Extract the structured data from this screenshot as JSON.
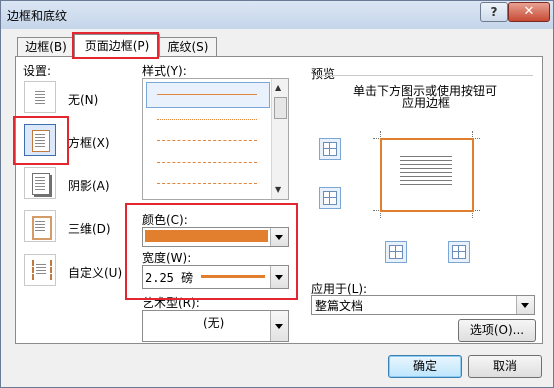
{
  "window": {
    "title": "边框和底纹",
    "help_glyph": "?",
    "close_glyph": "✕"
  },
  "tabs": [
    {
      "label": "边框(B)"
    },
    {
      "label": "页面边框(P)"
    },
    {
      "label": "底纹(S)"
    }
  ],
  "settings": {
    "heading": "设置:",
    "items": [
      {
        "label": "无(N)"
      },
      {
        "label": "方框(X)"
      },
      {
        "label": "阴影(A)"
      },
      {
        "label": "三维(D)"
      },
      {
        "label": "自定义(U)"
      }
    ]
  },
  "style": {
    "heading": "样式(Y):"
  },
  "color": {
    "label": "颜色(C):",
    "value_hex": "#e27f2f"
  },
  "width": {
    "label": "宽度(W):",
    "value": "2.25 磅"
  },
  "art": {
    "label": "艺术型(R):",
    "value": "(无)"
  },
  "preview": {
    "heading": "预览",
    "instruction_line1": "单击下方图示或使用按钮可",
    "instruction_line2": "应用边框",
    "border_color_hex": "#e27f2f"
  },
  "apply_to": {
    "label": "应用于(L):",
    "value": "整篇文档"
  },
  "buttons": {
    "options": "选项(O)...",
    "ok": "确定",
    "cancel": "取消"
  },
  "accent_colors": {
    "highlight_red": "#e3262f",
    "orange": "#e27f2f"
  }
}
